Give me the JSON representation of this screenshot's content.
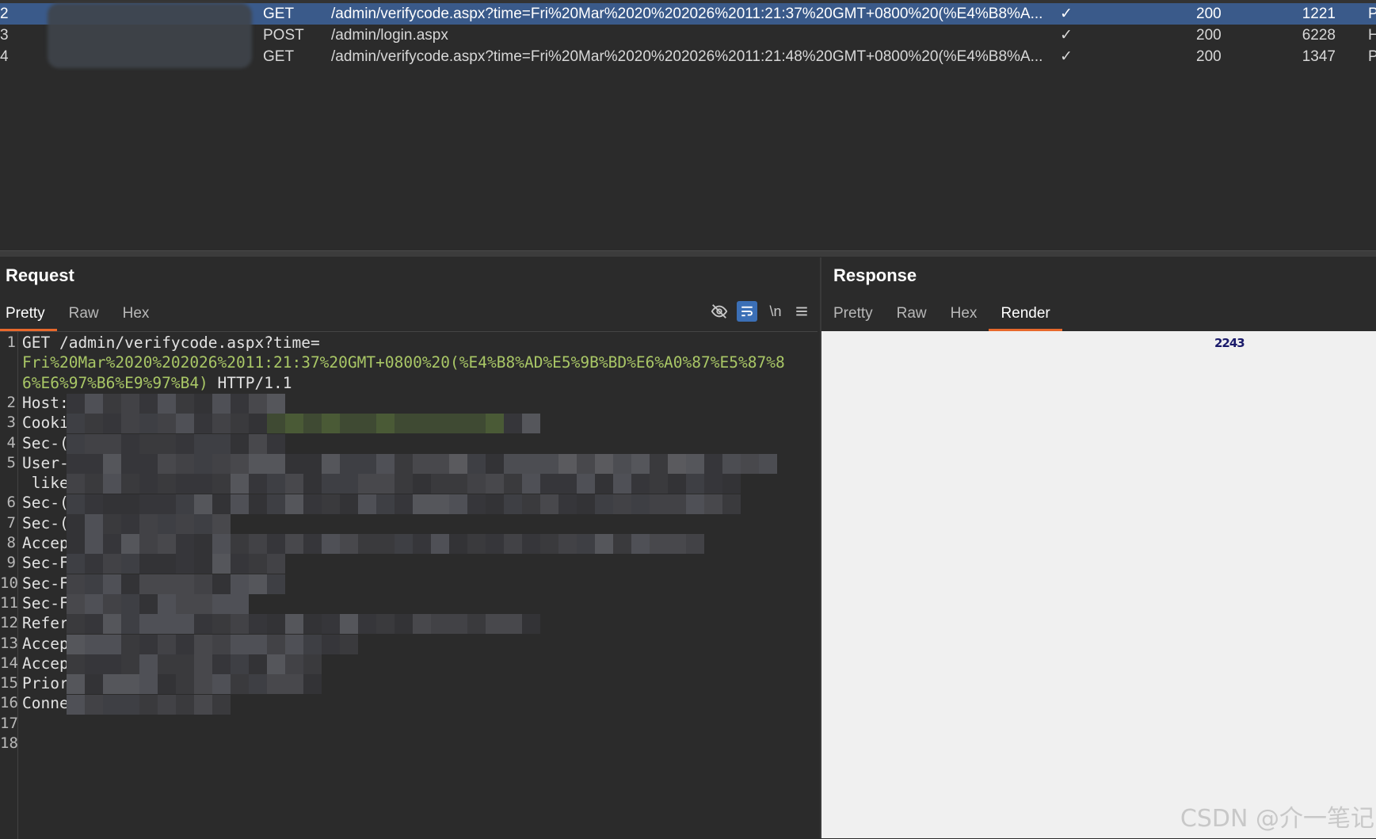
{
  "history": {
    "rows": [
      {
        "num": "2",
        "method": "GET",
        "url": "/admin/verifycode.aspx?time=Fri%20Mar%2020%202026%2011:21:37%20GMT+0800%20(%E4%B8%A...",
        "check": "✓",
        "status": "200",
        "length": "1221",
        "mime": "P",
        "selected": true
      },
      {
        "num": "3",
        "method": "POST",
        "url": "/admin/login.aspx",
        "check": "✓",
        "status": "200",
        "length": "6228",
        "mime": "H",
        "selected": false
      },
      {
        "num": "4",
        "method": "GET",
        "url": "/admin/verifycode.aspx?time=Fri%20Mar%2020%202026%2011:21:48%20GMT+0800%20(%E4%B8%A...",
        "check": "✓",
        "status": "200",
        "length": "1347",
        "mime": "P",
        "selected": false
      }
    ]
  },
  "request": {
    "title": "Request",
    "tabs": [
      "Pretty",
      "Raw",
      "Hex"
    ],
    "active_tab": "Pretty",
    "toolbar": {
      "newline_label": "\\n",
      "hide_icon": "eye-slash-icon",
      "wrap_icon": "wrap-icon",
      "menu_icon": "hamburger-icon"
    },
    "gutter": [
      "1",
      "",
      "",
      "2",
      "3",
      "4",
      "5",
      "",
      "6",
      "7",
      "8",
      "9",
      "10",
      "11",
      "12",
      "13",
      "14",
      "15",
      "16",
      "17",
      "18"
    ],
    "lines": [
      {
        "text": "GET /admin/verifycode.aspx?time=",
        "highlight": ""
      },
      {
        "text": "",
        "highlight": "Fri%20Mar%2020%202026%2011:21:37%20GMT+0800%20(%E4%B8%AD%E5%9B%BD%E6%A0%87%E5%87%8"
      },
      {
        "text": " HTTP/1.1",
        "highlight": "6%E6%97%B6%E9%97%B4)"
      },
      {
        "text": "Host: ",
        "highlight": ""
      },
      {
        "text": "Cooki",
        "highlight": ""
      },
      {
        "text": "Sec-(",
        "highlight": ""
      },
      {
        "text": "User-",
        "highlight": ""
      },
      {
        "text": " like",
        "highlight": ""
      },
      {
        "text": "Sec-(",
        "highlight": ""
      },
      {
        "text": "Sec-(",
        "highlight": ""
      },
      {
        "text": "Accep",
        "highlight": ""
      },
      {
        "text": "Sec-F",
        "highlight": ""
      },
      {
        "text": "Sec-F",
        "highlight": ""
      },
      {
        "text": "Sec-F",
        "highlight": ""
      },
      {
        "text": "Refer",
        "highlight": ""
      },
      {
        "text": "Accep",
        "highlight": ""
      },
      {
        "text": "Accep",
        "highlight": ""
      },
      {
        "text": "Prior",
        "highlight": ""
      },
      {
        "text": "Conne",
        "highlight": ""
      },
      {
        "text": "",
        "highlight": ""
      },
      {
        "text": "",
        "highlight": ""
      }
    ]
  },
  "response": {
    "title": "Response",
    "tabs": [
      "Pretty",
      "Raw",
      "Hex",
      "Render"
    ],
    "active_tab": "Render",
    "captcha_text": "2243"
  },
  "watermark": "CSDN @介一笔记"
}
